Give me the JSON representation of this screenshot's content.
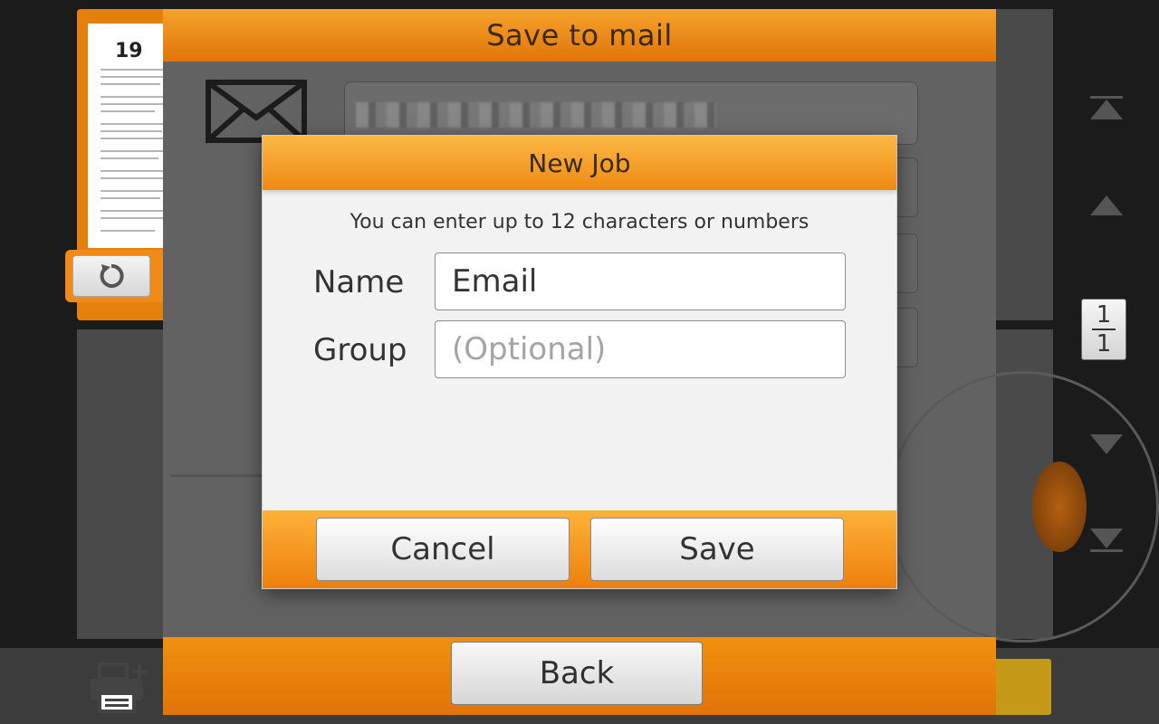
{
  "background": {
    "doc_page_number": "19",
    "page_indicator": {
      "current": "1",
      "total": "1"
    },
    "icons": {
      "rotate": "rotate-icon",
      "nav_first": "arrow-top-icon",
      "nav_up": "arrow-up-icon",
      "nav_down": "arrow-down-icon",
      "nav_last": "arrow-bottom-icon",
      "printer": "printer-add-icon"
    }
  },
  "mail_dialog": {
    "title": "Save to mail",
    "back_label": "Back",
    "icon": "envelope-icon"
  },
  "new_job": {
    "title": "New Job",
    "hint": "You can enter up to 12 characters or numbers",
    "name_label": "Name",
    "name_value": "Email",
    "group_label": "Group",
    "group_placeholder": "(Optional)",
    "cancel_label": "Cancel",
    "save_label": "Save"
  },
  "colors": {
    "accent_orange": "#f08a18",
    "header_text": "#3b2a13"
  }
}
